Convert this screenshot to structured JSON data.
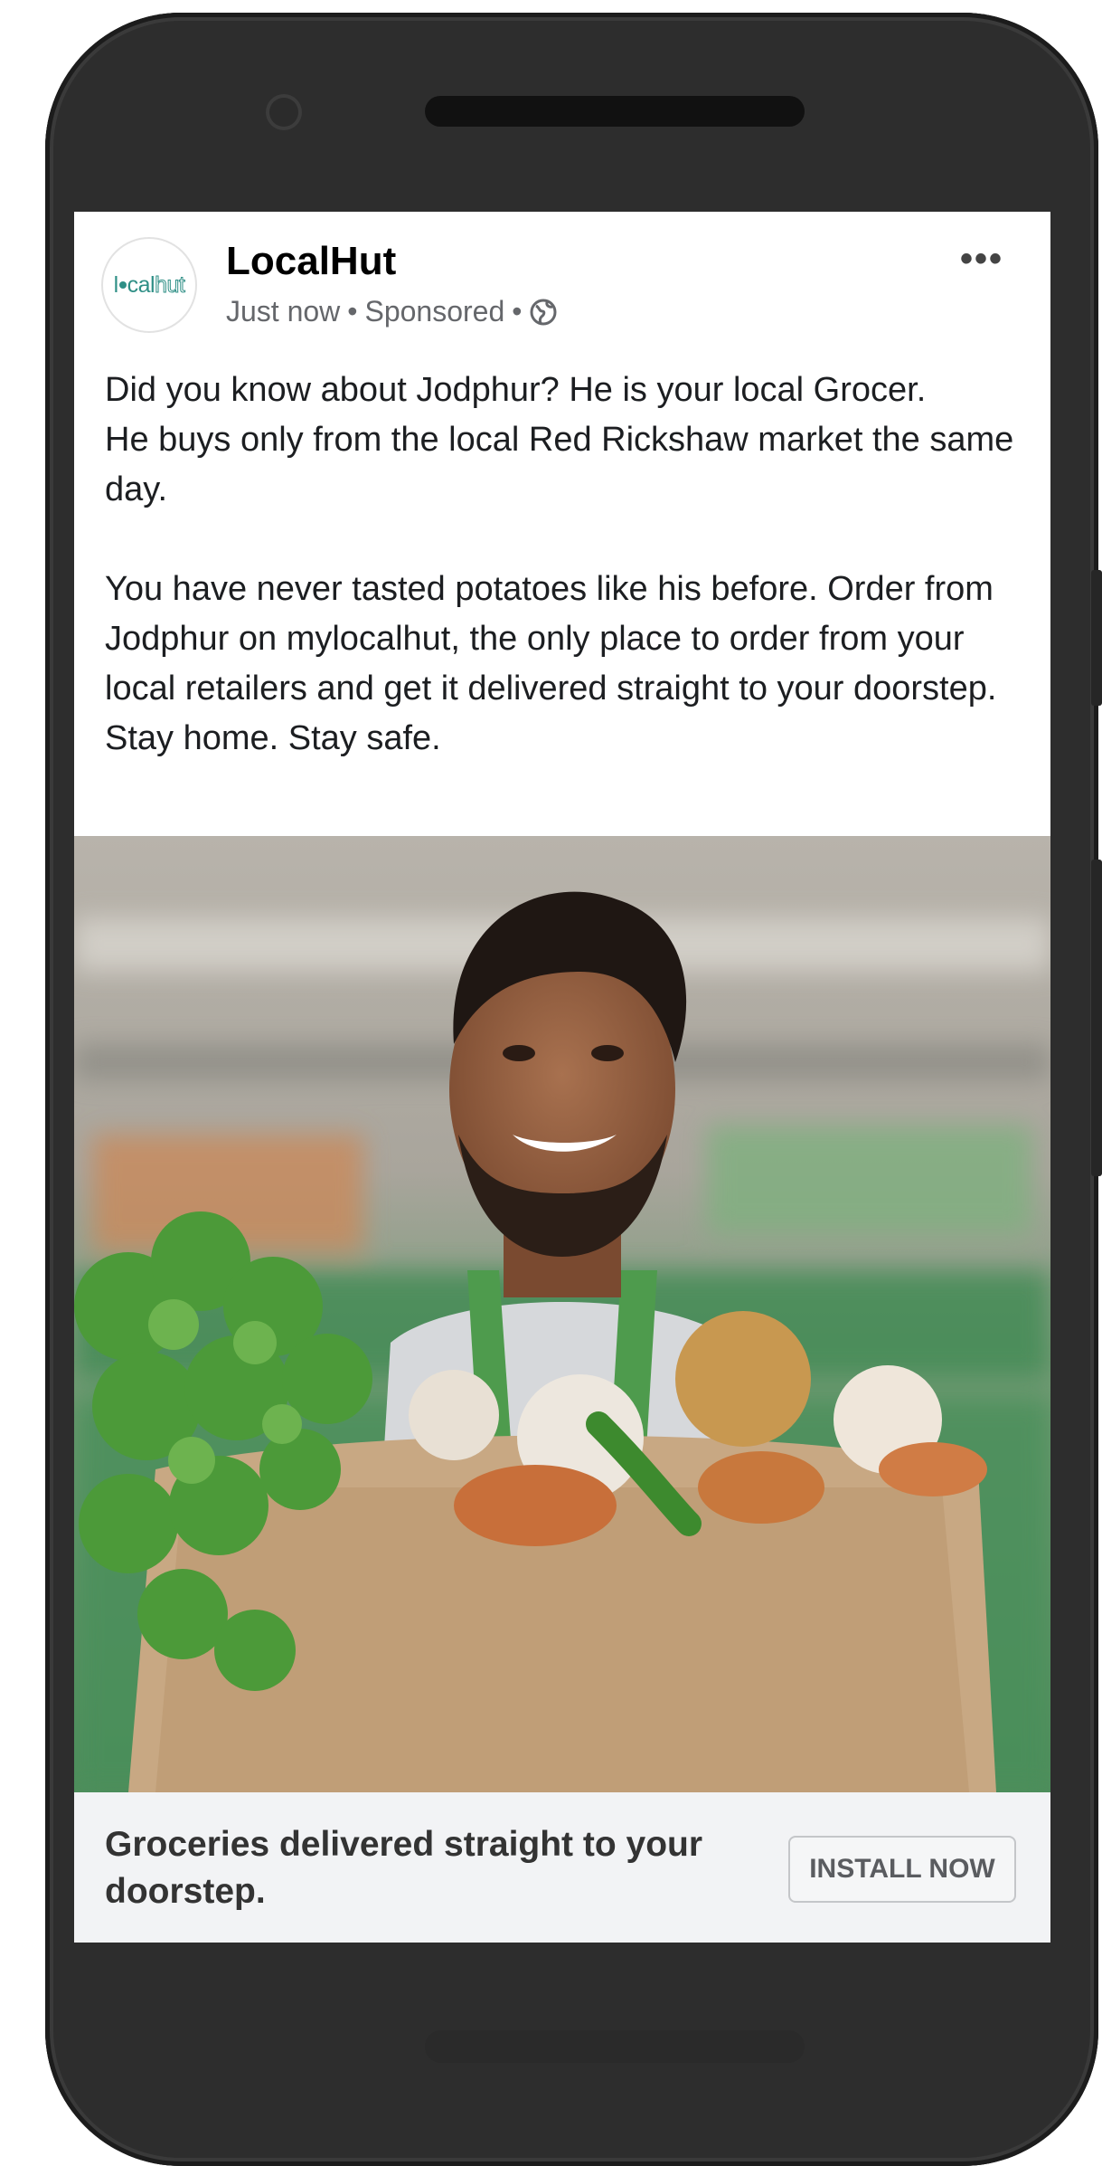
{
  "post": {
    "page_name": "LocalHut",
    "avatar_text_l": "l",
    "avatar_text_cal": "cal",
    "avatar_text_hut": "hut",
    "time": "Just now",
    "sponsored": "Sponsored",
    "separator": "•",
    "more_icon": "•••",
    "body": [
      "Did you know about Jodphur? He is your local Grocer.",
      "He buys only from the local Red Rickshaw market the same day.",
      "",
      "You have never tasted potatoes like his before. Order from Jodphur on mylocalhut, the only place to order from your local retailers and get it delivered straight to your doorstep. Stay home. Stay safe."
    ]
  },
  "ad": {
    "headline": "Groceries delivered straight to your doorstep.",
    "cta_label": "INSTALL NOW"
  },
  "colors": {
    "brand": "#2f8f86",
    "phone_body": "#2d2d2d",
    "footer_bg": "#f2f3f5",
    "meta_text": "#65676b"
  },
  "icons": [
    "globe-icon",
    "more-options-icon"
  ]
}
